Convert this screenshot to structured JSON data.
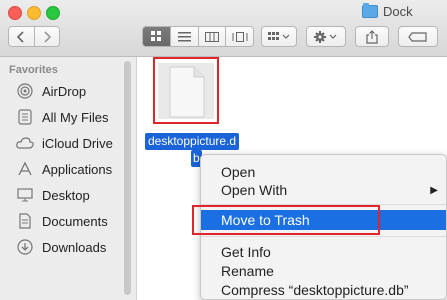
{
  "window": {
    "title": "Dock"
  },
  "toolbar": {
    "back_icon": "chevron-left",
    "forward_icon": "chevron-right",
    "view_icon_label": "⊞",
    "view_list_label": "☰",
    "view_columns_label": "▥",
    "view_coverflow_label": "▯",
    "arrange_label": "⊞ ▾",
    "action_label": "⚙ ▾",
    "share_label": "⇪",
    "tags_label": "⬭"
  },
  "sidebar": {
    "header": "Favorites",
    "items": [
      {
        "label": "AirDrop",
        "icon": "airdrop-icon"
      },
      {
        "label": "All My Files",
        "icon": "all-files-icon"
      },
      {
        "label": "iCloud Drive",
        "icon": "cloud-icon"
      },
      {
        "label": "Applications",
        "icon": "applications-icon"
      },
      {
        "label": "Desktop",
        "icon": "desktop-icon"
      },
      {
        "label": "Documents",
        "icon": "documents-icon"
      },
      {
        "label": "Downloads",
        "icon": "downloads-icon"
      }
    ]
  },
  "file": {
    "name_line1": "desktoppicture.d",
    "name_line2": "b"
  },
  "context_menu": {
    "items": [
      {
        "label": "Open"
      },
      {
        "label": "Open With",
        "submenu": true
      },
      {
        "label": "Move to Trash",
        "highlighted": true
      },
      {
        "label": "Get Info"
      },
      {
        "label": "Rename"
      },
      {
        "label": "Compress “desktoppicture.db”"
      }
    ]
  },
  "colors": {
    "highlight": "#1a6fe2",
    "annotation_red": "#e0262b",
    "selection": "#1a63d8"
  }
}
